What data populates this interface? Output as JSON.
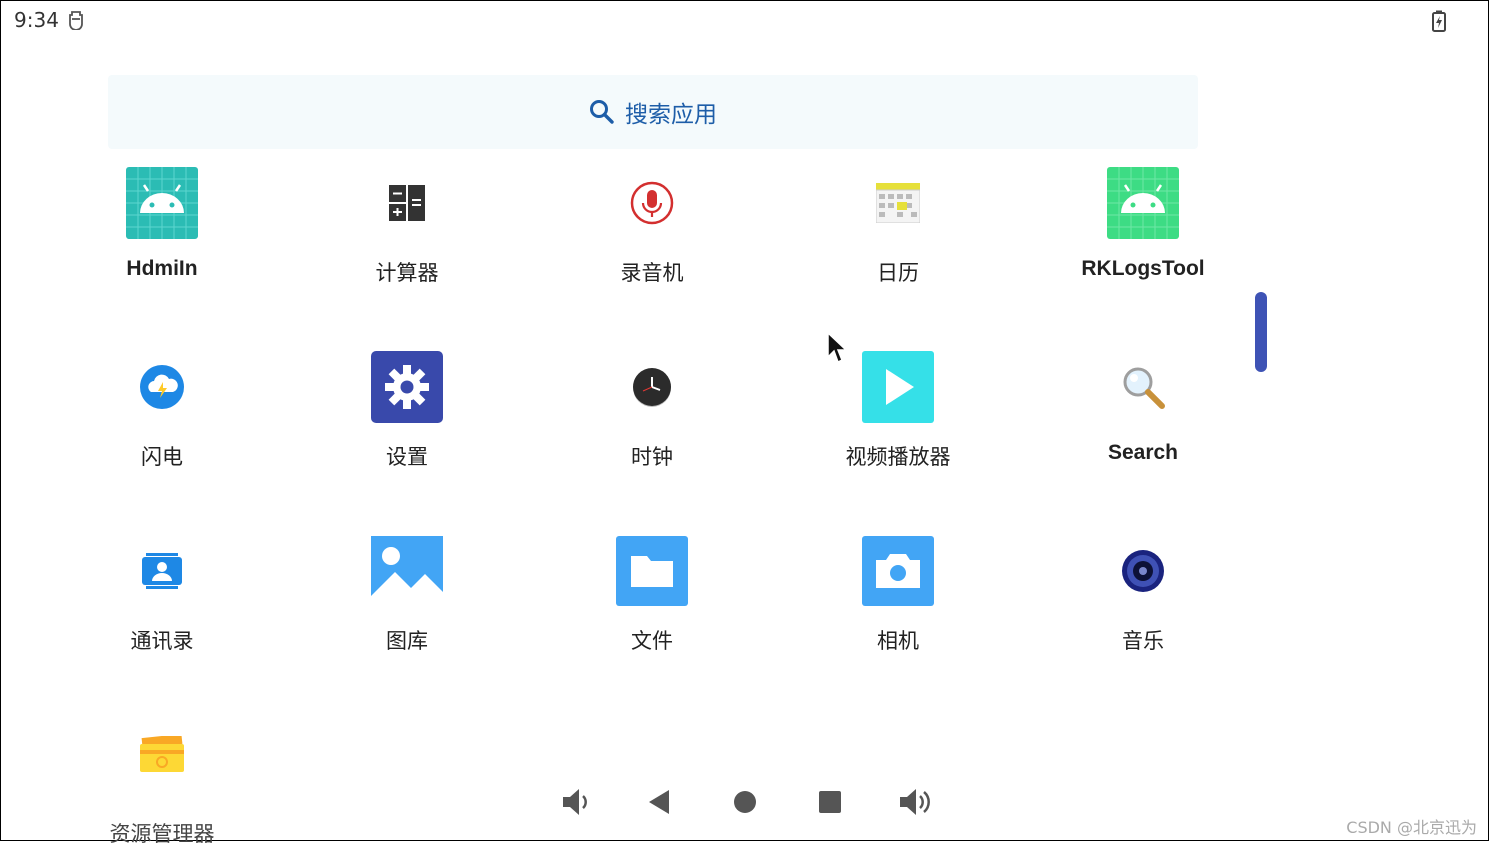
{
  "status_bar": {
    "time": "9:34"
  },
  "search": {
    "placeholder": "搜索应用"
  },
  "apps": [
    {
      "label": "HdmiIn",
      "icon": "android-grid-icon"
    },
    {
      "label": "计算器",
      "icon": "calculator-icon"
    },
    {
      "label": "录音机",
      "icon": "microphone-icon"
    },
    {
      "label": "日历",
      "icon": "calendar-icon"
    },
    {
      "label": "RKLogsTool",
      "icon": "android-icon"
    },
    {
      "label": "闪电",
      "icon": "lightning-cloud-icon"
    },
    {
      "label": "设置",
      "icon": "gear-icon"
    },
    {
      "label": "时钟",
      "icon": "clock-icon"
    },
    {
      "label": "视频播放器",
      "icon": "video-play-icon"
    },
    {
      "label": "Search",
      "icon": "magnifier-icon"
    },
    {
      "label": "通讯录",
      "icon": "contacts-icon"
    },
    {
      "label": "图库",
      "icon": "gallery-icon"
    },
    {
      "label": "文件",
      "icon": "folder-icon"
    },
    {
      "label": "相机",
      "icon": "camera-icon"
    },
    {
      "label": "音乐",
      "icon": "speaker-icon"
    },
    {
      "label": "资源管理器",
      "icon": "file-manager-icon"
    }
  ],
  "nav": {
    "buttons": [
      "volume-down-icon",
      "back-icon",
      "home-icon",
      "recents-icon",
      "volume-up-icon"
    ]
  },
  "watermark": "CSDN @北京迅为",
  "colors": {
    "accent": "#1d5da8",
    "scrollbar": "#3e53b5",
    "search_bg": "#f4fafc"
  }
}
